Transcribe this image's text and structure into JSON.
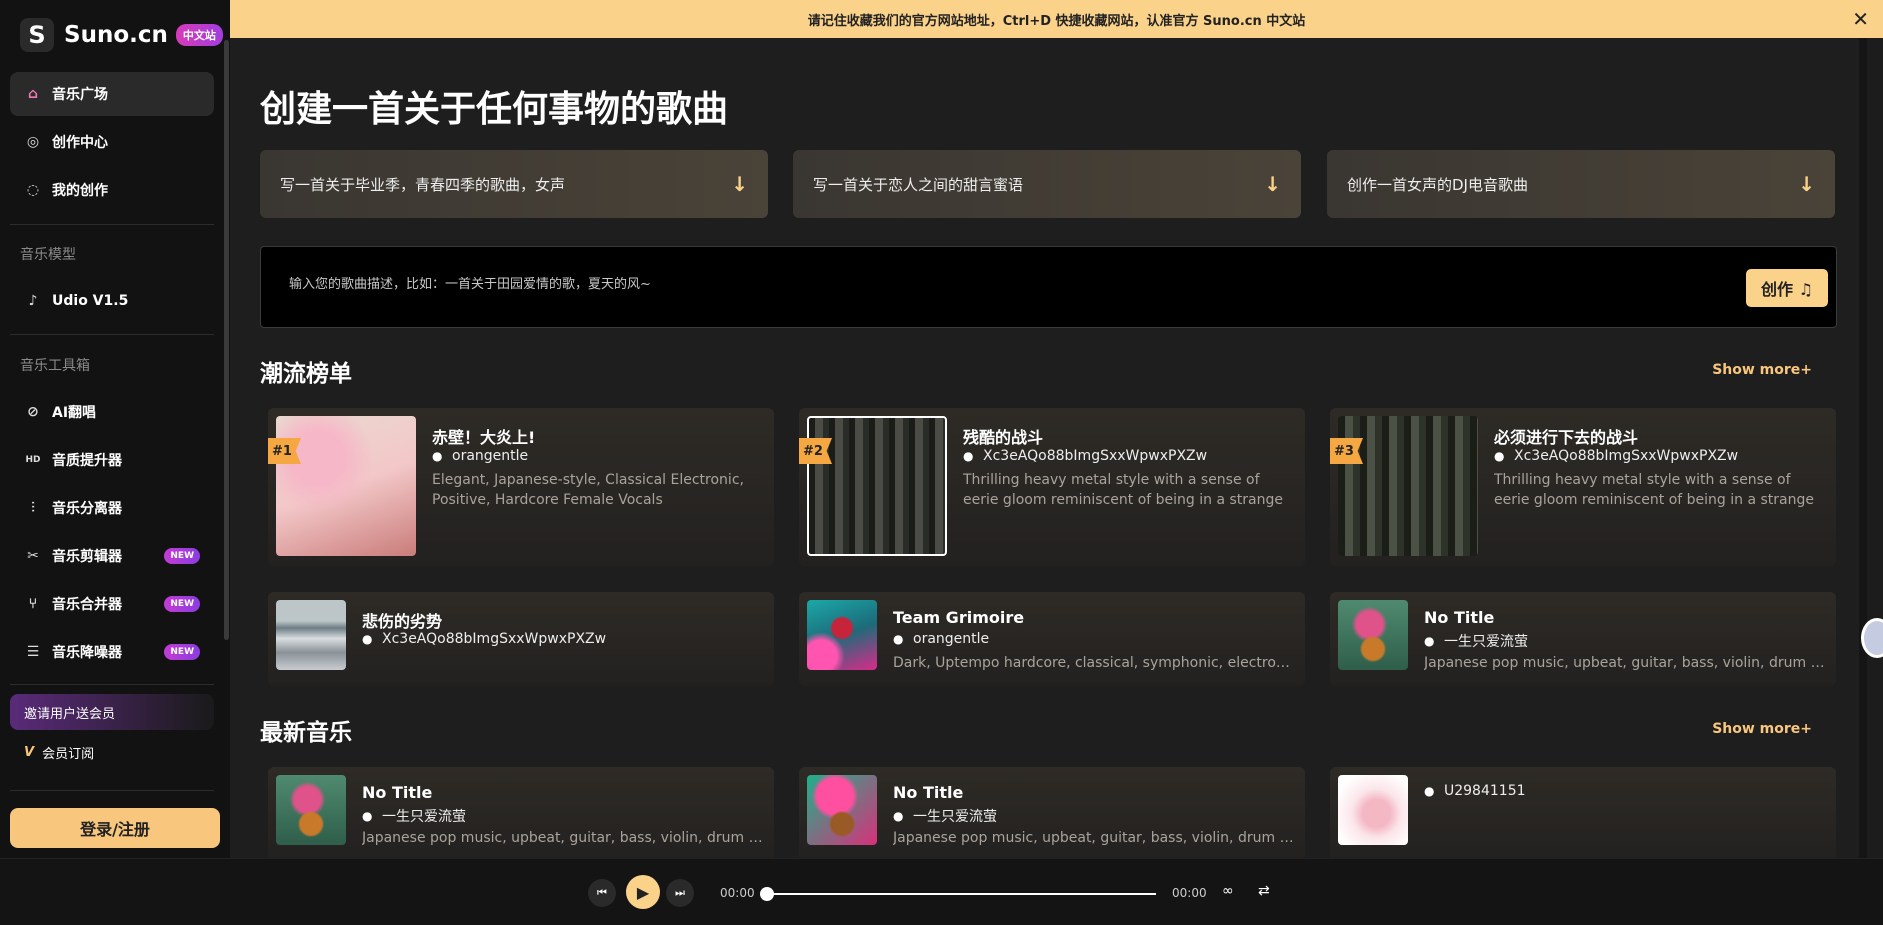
{
  "brand": {
    "name": "Suno.cn",
    "badge": "中文站",
    "logo_letter": "S"
  },
  "banner": {
    "text": "请记住收藏我们的官方网站地址，Ctrl+D 快捷收藏网站，认准官方 Suno.cn 中文站",
    "close": "✕"
  },
  "sidebar": {
    "nav": [
      {
        "label": "音乐广场",
        "icon": "home-icon",
        "glyph": "⌂"
      },
      {
        "label": "创作中心",
        "icon": "compose-icon",
        "glyph": "◎"
      },
      {
        "label": "我的创作",
        "icon": "chat-icon",
        "glyph": "◌"
      }
    ],
    "model_section": "音乐模型",
    "model": {
      "label": "Udio V1.5",
      "icon": "music-note-icon",
      "glyph": "♪"
    },
    "tools_section": "音乐工具箱",
    "tools": [
      {
        "label": "AI翻唱",
        "icon": "microphone-icon",
        "glyph": "⊘",
        "badge": ""
      },
      {
        "label": "音质提升器",
        "icon": "hd-icon",
        "glyph": "HD",
        "badge": ""
      },
      {
        "label": "音乐分离器",
        "icon": "equalizer-icon",
        "glyph": "⫶",
        "badge": ""
      },
      {
        "label": "音乐剪辑器",
        "icon": "scissors-icon",
        "glyph": "✂",
        "badge": "NEW"
      },
      {
        "label": "音乐合并器",
        "icon": "merge-icon",
        "glyph": "⑂",
        "badge": "NEW"
      },
      {
        "label": "音乐降噪器",
        "icon": "sliders-icon",
        "glyph": "☰",
        "badge": "NEW"
      }
    ],
    "invite": "邀请用户送会员",
    "subscribe": "会员订阅",
    "subscribe_icon": "V",
    "login": "登录/注册"
  },
  "main": {
    "title": "创建一首关于任何事物的歌曲",
    "prompts": [
      "写一首关于毕业季，青春四季的歌曲，女声",
      "写一首关于恋人之间的甜言蜜语",
      "创作一首女声的DJ电音歌曲"
    ],
    "prompt_arrow": "↓",
    "input_placeholder": "输入您的歌曲描述，比如：一首关于田园爱情的歌，夏天的风~",
    "create_button": "创作 ♫",
    "trending": {
      "title": "潮流榜单",
      "show_more": "Show more+",
      "top": [
        {
          "rank": "#1",
          "title": "赤壁！大炎上!",
          "author": "orangentle",
          "desc": "Elegant, Japanese-style, Classical Electronic, Positive, Hardcore Female Vocals"
        },
        {
          "rank": "#2",
          "title": "残酷的战斗",
          "author": "Xc3eAQo88bImgSxxWpwxPXZw",
          "desc": "Thrilling heavy metal style with a sense of eerie gloom reminiscent of being in a strange place."
        },
        {
          "rank": "#3",
          "title": "必须进行下去的战斗",
          "author": "Xc3eAQo88bImgSxxWpwxPXZw",
          "desc": "Thrilling heavy metal style with a sense of eerie gloom reminiscent of being in a strange place."
        }
      ],
      "more": [
        {
          "title": "悲伤的劣势",
          "author": "Xc3eAQo88bImgSxxWpwxPXZw",
          "desc": ""
        },
        {
          "title": "Team Grimoire",
          "author": "orangentle",
          "desc": "Dark, Uptempo hardcore, classical, symphonic, electronic ..."
        },
        {
          "title": "No Title",
          "author": "一生只爱流萤",
          "desc": "Japanese pop music, upbeat, guitar, bass, violin, drum set, ..."
        }
      ]
    },
    "latest": {
      "title": "最新音乐",
      "show_more": "Show more+",
      "items": [
        {
          "title": "No Title",
          "author": "一生只爱流萤",
          "desc": "Japanese pop music, upbeat, guitar, bass, violin, drum set, ..."
        },
        {
          "title": "No Title",
          "author": "一生只爱流萤",
          "desc": "Japanese pop music, upbeat, guitar, bass, violin, drum set, ..."
        },
        {
          "title": "",
          "author": "U29841151",
          "desc": ""
        }
      ]
    }
  },
  "player": {
    "current_time": "00:00",
    "total_time": "00:00",
    "progress": 0,
    "loop_icon": "∞",
    "repeat_icon": "⇄"
  }
}
